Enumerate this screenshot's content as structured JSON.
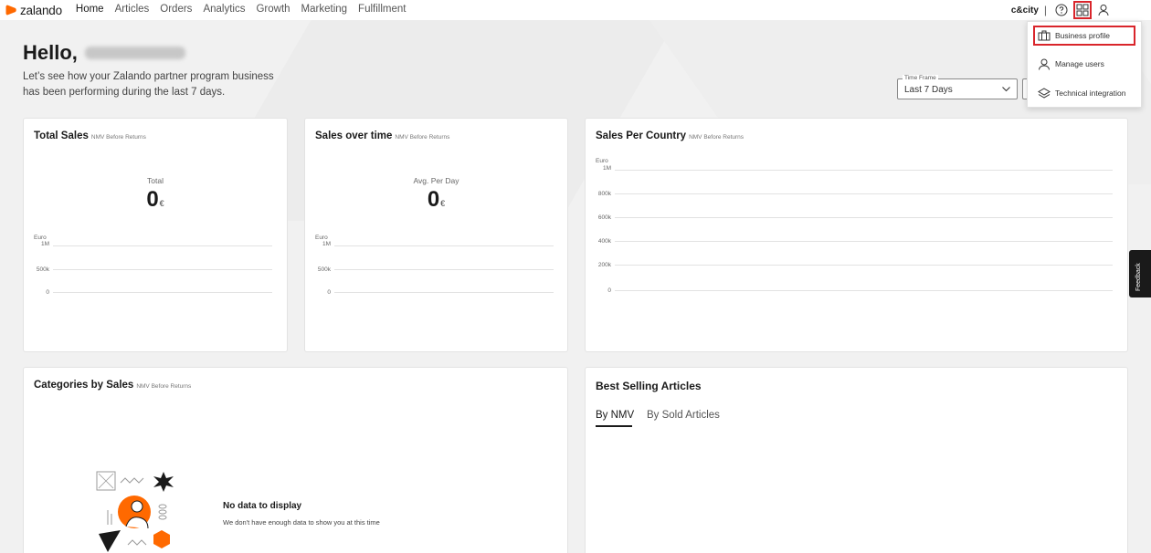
{
  "brand": {
    "name": "zalando",
    "accent": "#ff6900"
  },
  "nav": {
    "items": [
      "Home",
      "Articles",
      "Orders",
      "Analytics",
      "Growth",
      "Marketing",
      "Fulfillment"
    ],
    "active": "Home"
  },
  "header": {
    "shop_name": "c&city",
    "separator": "|",
    "icons": [
      "help-icon",
      "apps-grid-icon",
      "user-icon"
    ]
  },
  "greeting": {
    "hello": "Hello,",
    "intro_line1": "Let’s see how your Zalando partner program business",
    "intro_line2": "has been performing during the last 7 days."
  },
  "timeframe": {
    "label": "Time Frame",
    "value": "Last 7 Days"
  },
  "menu": {
    "items": [
      {
        "label": "Business profile",
        "icon": "briefcase-icon"
      },
      {
        "label": "Manage users",
        "icon": "user-icon"
      },
      {
        "label": "Technical integration",
        "icon": "layers-icon"
      }
    ]
  },
  "cards": {
    "total_sales": {
      "title": "Total Sales",
      "subtitle": "NMV Before Returns",
      "kpi_label": "Total",
      "kpi_value": "0",
      "currency": "€"
    },
    "sales_over_time": {
      "title": "Sales over time",
      "subtitle": "NMV Before Returns",
      "kpi_label": "Avg. Per Day",
      "kpi_value": "0",
      "currency": "€"
    },
    "sales_per_country": {
      "title": "Sales Per Country",
      "subtitle": "NMV Before Returns"
    },
    "categories": {
      "title": "Categories by Sales",
      "subtitle": "NMV Before Returns",
      "empty_title": "No data to display",
      "empty_text": "We don't have enough data to show you at this time"
    },
    "best_selling": {
      "title": "Best Selling Articles",
      "tabs": [
        "By NMV",
        "By Sold Articles"
      ],
      "active_tab": "By NMV"
    }
  },
  "small_axis": {
    "unit": "Euro",
    "ticks": [
      "1M",
      "500k",
      "0"
    ]
  },
  "country_axis": {
    "unit": "Euro",
    "ticks": [
      "1M",
      "800k",
      "600k",
      "400k",
      "200k",
      "0"
    ]
  },
  "feedback": {
    "label": "Feedback"
  },
  "colors": {
    "highlight": "#d9252b",
    "text": "#1a1a1a"
  }
}
